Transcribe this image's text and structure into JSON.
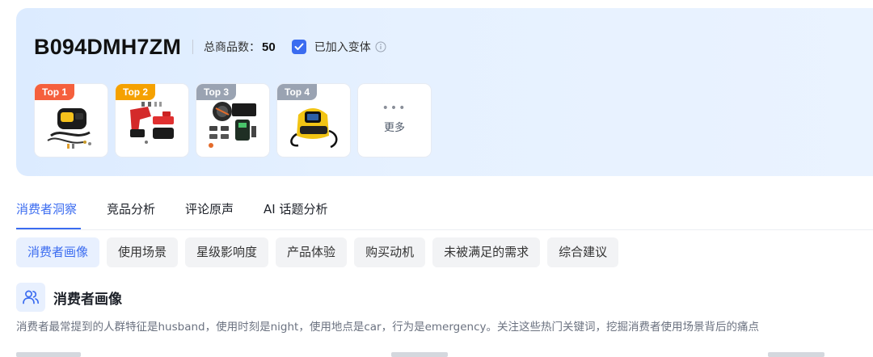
{
  "header": {
    "asin": "B094DMH7ZM",
    "total_label": "总商品数：",
    "total_value": "50",
    "variant_checked": true,
    "variant_label": "已加入变体",
    "info_icon": "info-icon"
  },
  "products": [
    {
      "badge": "Top 1",
      "badge_color": "#f5603d"
    },
    {
      "badge": "Top 2",
      "badge_color": "#f5a100"
    },
    {
      "badge": "Top 3",
      "badge_color": "#9aa3b2"
    },
    {
      "badge": "Top 4",
      "badge_color": "#9aa3b2"
    }
  ],
  "more": {
    "label": "更多",
    "icon": "more-dots-icon"
  },
  "tabs": [
    {
      "label": "消费者洞察",
      "active": true
    },
    {
      "label": "竞品分析",
      "active": false
    },
    {
      "label": "评论原声",
      "active": false
    },
    {
      "label": "AI 话题分析",
      "active": false
    }
  ],
  "subtabs": [
    {
      "label": "消费者画像",
      "active": true
    },
    {
      "label": "使用场景",
      "active": false
    },
    {
      "label": "星级影响度",
      "active": false
    },
    {
      "label": "产品体验",
      "active": false
    },
    {
      "label": "购买动机",
      "active": false
    },
    {
      "label": "未被满足的需求",
      "active": false
    },
    {
      "label": "综合建议",
      "active": false
    }
  ],
  "section": {
    "title": "消费者画像",
    "icon": "users-icon",
    "description": "消费者最常提到的人群特征是husband，使用时刻是night，使用地点是car，行为是emergency。关注这些热门关键词，挖掘消费者使用场景背后的痛点"
  },
  "colors": {
    "accent": "#3b6cf0",
    "header_bg": "#e3eeff"
  }
}
